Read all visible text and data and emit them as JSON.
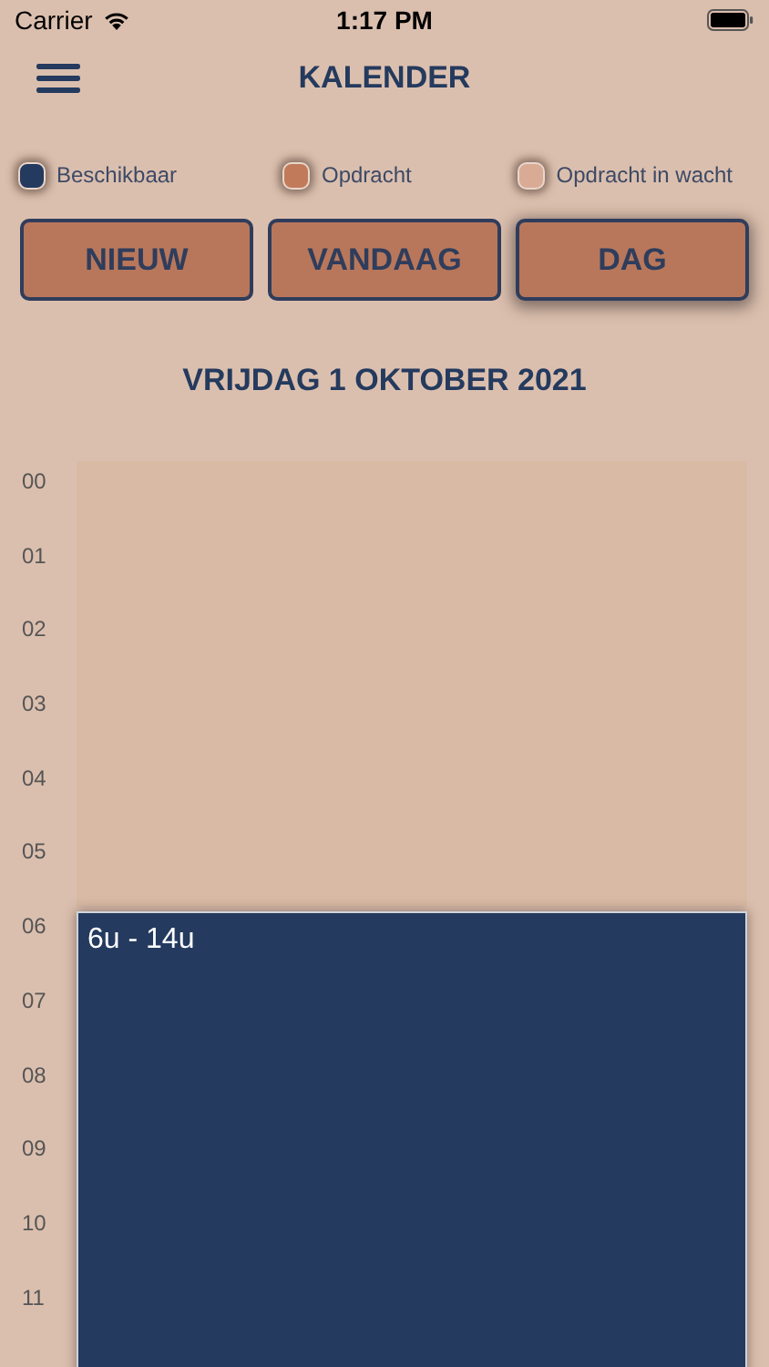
{
  "status_bar": {
    "carrier": "Carrier",
    "time": "1:17 PM"
  },
  "header": {
    "title": "KALENDER"
  },
  "legend": [
    {
      "label": "Beschikbaar",
      "color": "#243a5e"
    },
    {
      "label": "Opdracht",
      "color": "#c17a5a"
    },
    {
      "label": "Opdracht in wacht",
      "color": "#d9ab95"
    }
  ],
  "buttons": [
    {
      "label": "NIEUW",
      "selected": false
    },
    {
      "label": "VANDAAG",
      "selected": false
    },
    {
      "label": "DAG",
      "selected": true
    }
  ],
  "date": "VRIJDAG 1 OKTOBER 2021",
  "hours": [
    {
      "label": "00"
    },
    {
      "label": "01"
    },
    {
      "label": "02"
    },
    {
      "label": "03"
    },
    {
      "label": "04"
    },
    {
      "label": "05"
    },
    {
      "label": "06",
      "event": {
        "label": "6u - 14u",
        "color": "#243a5e"
      }
    },
    {
      "label": "07"
    },
    {
      "label": "08"
    },
    {
      "label": "09"
    },
    {
      "label": "10"
    },
    {
      "label": "11"
    }
  ]
}
